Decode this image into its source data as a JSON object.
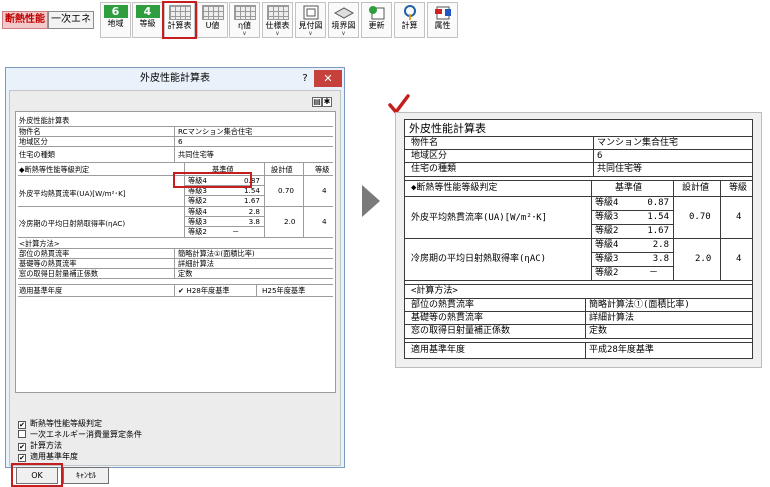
{
  "toolbar": {
    "tab_active": "断熱性能",
    "tab_other": "一次エネ",
    "buttons": [
      {
        "icon_text": "6",
        "label": "地域"
      },
      {
        "icon_text": "4",
        "label": "等級"
      },
      {
        "label": "計算表"
      },
      {
        "label": "U値"
      },
      {
        "label": "η値"
      },
      {
        "label": "仕様表"
      },
      {
        "label": "見付図"
      },
      {
        "label": "境界図"
      },
      {
        "label": "更新"
      },
      {
        "label": "計算"
      },
      {
        "label": "属性"
      }
    ],
    "colors": {
      "active_tab_text": "#c00000",
      "number_badge": "#2e9e3e",
      "highlight": "#c41e1e"
    }
  },
  "dialog": {
    "title": "外皮性能計算表",
    "help": "?",
    "close": "✕",
    "sheet": {
      "heading": "外皮性能計算表",
      "rows_basic": [
        {
          "label": "物件名",
          "value": "RCマンション集合住宅"
        },
        {
          "label": "地域区分",
          "value": "6"
        },
        {
          "label": "住宅の種類",
          "value": "共同住宅等"
        }
      ],
      "grade_header": {
        "label": "◆断熱等性能等級判定",
        "base": "基準値",
        "design": "設計値",
        "grade": "等級"
      },
      "ua": {
        "label": "外皮平均熱貫流率(UA)[W/m²･K]",
        "rows": [
          {
            "grade": "等級4",
            "value": "0.87"
          },
          {
            "grade": "等級3",
            "value": "1.54"
          },
          {
            "grade": "等級2",
            "value": "1.67"
          }
        ],
        "design": "0.70",
        "result": "4"
      },
      "eta": {
        "label": "冷房期の平均日射熱取得率(ηAC)",
        "rows": [
          {
            "grade": "等級4",
            "value": "2.8"
          },
          {
            "grade": "等級3",
            "value": "3.8"
          },
          {
            "grade": "等級2",
            "value": "－"
          }
        ],
        "design": "2.0",
        "result": "4"
      },
      "method_header": "<計算方法>",
      "methods": [
        {
          "label": "部位の熱貫流率",
          "value": "簡略計算法①(面積比率)"
        },
        {
          "label": "基礎等の熱貫流率",
          "value": "詳細計算法"
        },
        {
          "label": "窓の取得日射量補正係数",
          "value": "定数"
        }
      ],
      "standard": {
        "label": "適用基準年度",
        "opt1": "H28年度基準",
        "opt2": "H25年度基準"
      }
    },
    "options": [
      {
        "checked": true,
        "label": "断熱等性能等級判定"
      },
      {
        "checked": false,
        "label": "一次エネルギー消費量算定条件"
      },
      {
        "checked": true,
        "label": "計算方法"
      },
      {
        "checked": true,
        "label": "適用基準年度"
      }
    ],
    "ok": "OK",
    "cancel": "ｷｬﾝｾﾙ"
  },
  "preview": {
    "heading": "外皮性能計算表",
    "rows_basic": [
      {
        "label": "物件名",
        "value": "マンション集合住宅"
      },
      {
        "label": "地域区分",
        "value": "6"
      },
      {
        "label": "住宅の種類",
        "value": "共同住宅等"
      }
    ],
    "grade_header": {
      "label": "◆断熱等性能等級判定",
      "base": "基準値",
      "design": "設計値",
      "grade": "等級"
    },
    "ua": {
      "label": "外皮平均熱貫流率(UA)[W/m²･K]",
      "rows": [
        {
          "grade": "等級4",
          "value": "0.87"
        },
        {
          "grade": "等級3",
          "value": "1.54"
        },
        {
          "grade": "等級2",
          "value": "1.67"
        }
      ],
      "design": "0.70",
      "result": "4"
    },
    "eta": {
      "label": "冷房期の平均日射熱取得率(ηAC)",
      "rows": [
        {
          "grade": "等級4",
          "value": "2.8"
        },
        {
          "grade": "等級3",
          "value": "3.8"
        },
        {
          "grade": "等級2",
          "value": "－"
        }
      ],
      "design": "2.0",
      "result": "4"
    },
    "method_header": "<計算方法>",
    "methods": [
      {
        "label": "部位の熱貫流率",
        "value": "簡略計算法①(面積比率)"
      },
      {
        "label": "基礎等の熱貫流率",
        "value": "詳細計算法"
      },
      {
        "label": "窓の取得日射量補正係数",
        "value": "定数"
      }
    ],
    "standard": {
      "label": "適用基準年度",
      "value": "平成28年度基準"
    }
  }
}
